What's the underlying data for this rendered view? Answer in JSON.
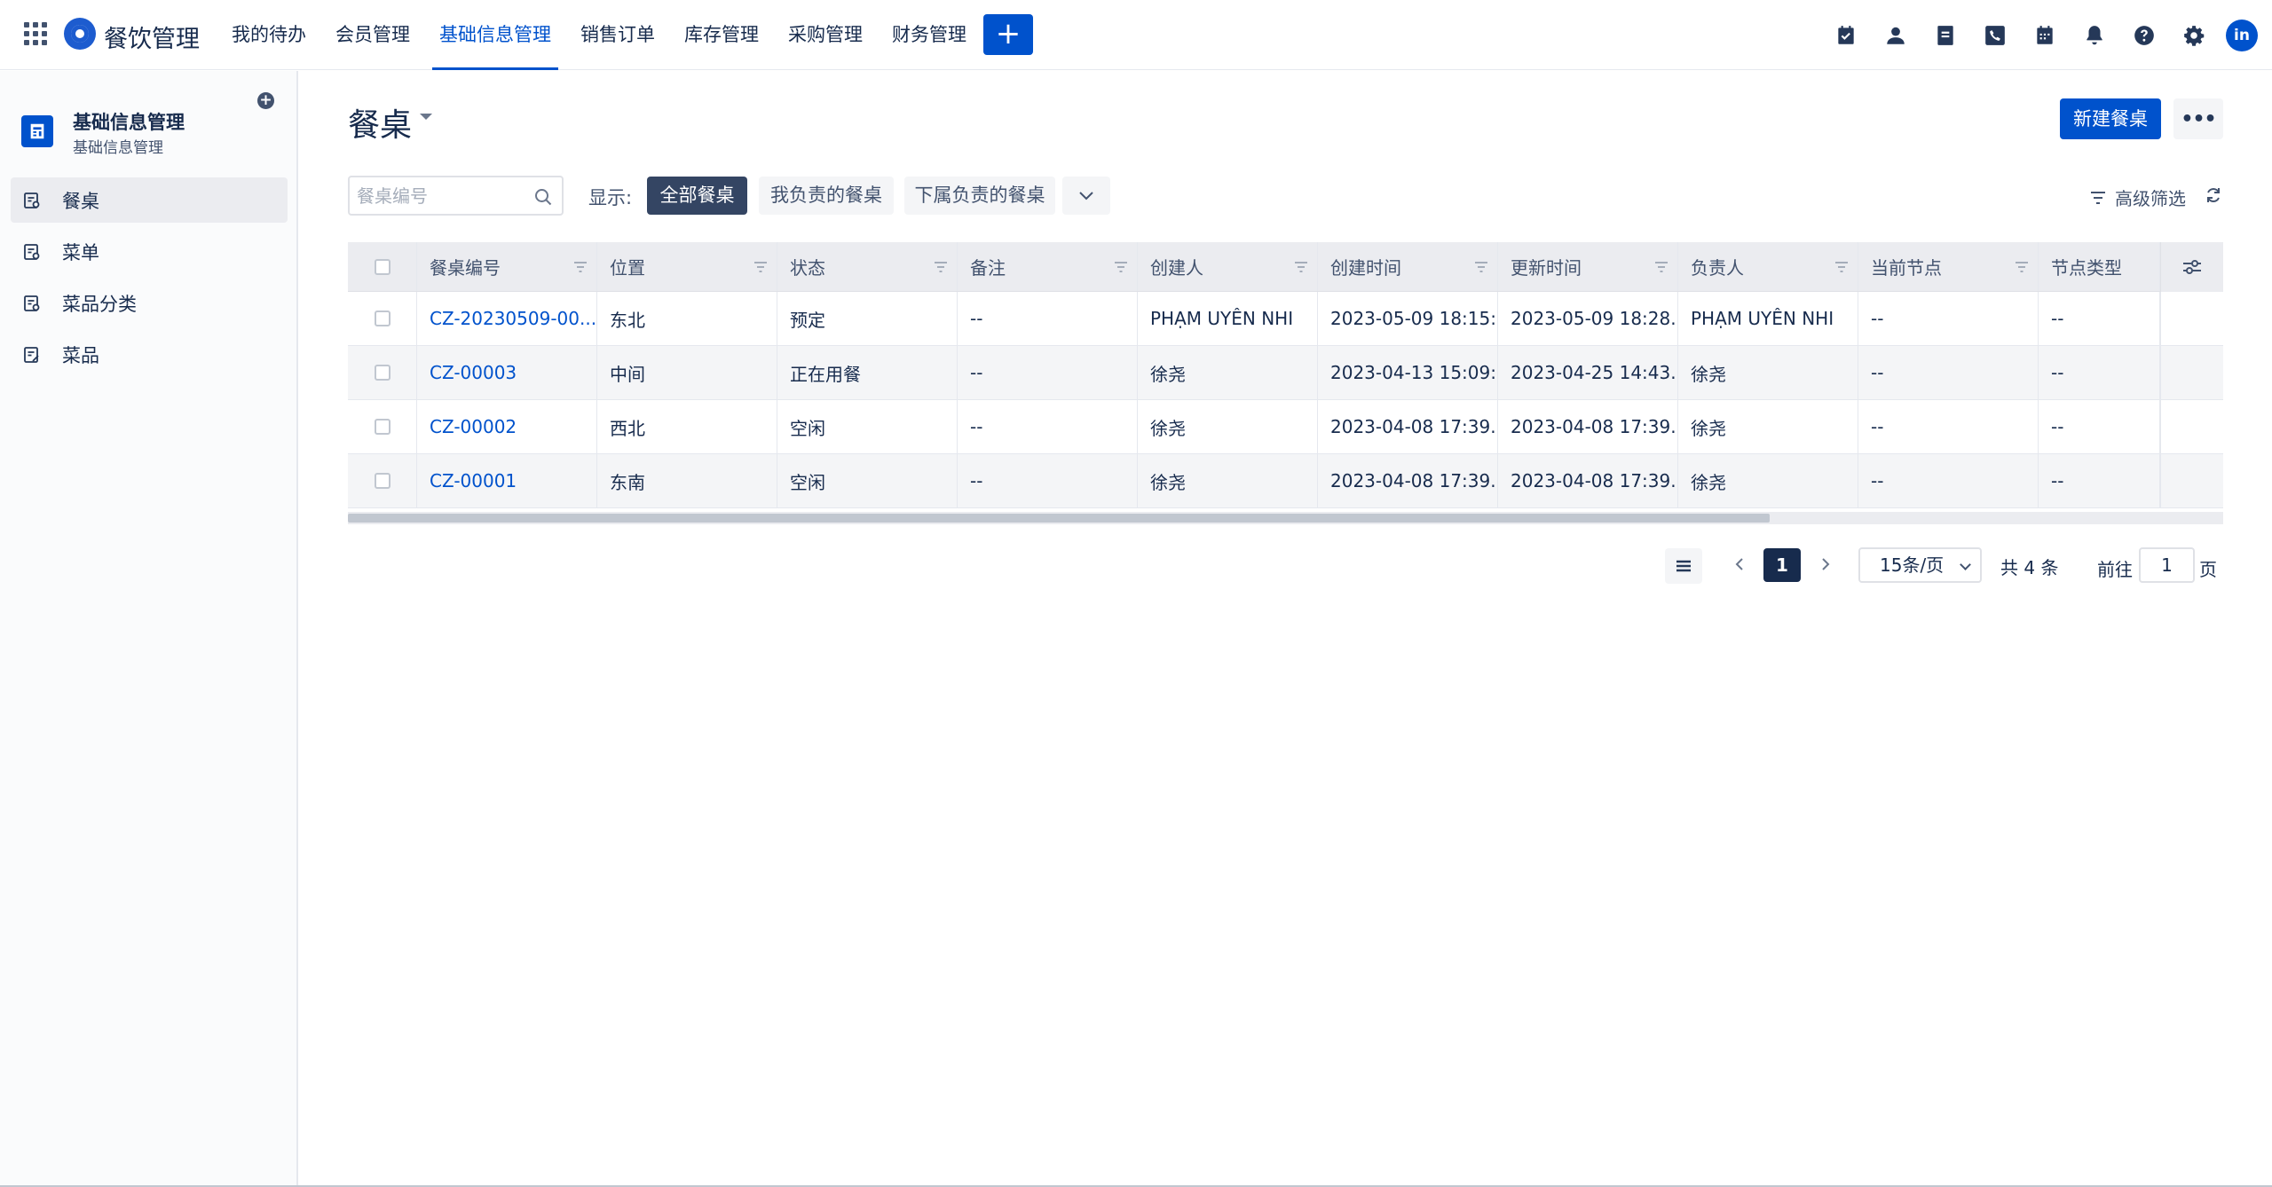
{
  "app": {
    "title": "餐饮管理",
    "nav": [
      "我的待办",
      "会员管理",
      "基础信息管理",
      "销售订单",
      "库存管理",
      "采购管理",
      "财务管理"
    ],
    "active_nav": "基础信息管理",
    "create_label": "+",
    "avatar_text": "in",
    "icons": [
      "calendar-check-icon",
      "user-icon",
      "document-icon",
      "phone-icon",
      "calendar-icon",
      "bell-icon",
      "help-icon",
      "gear-icon"
    ]
  },
  "sidebar": {
    "title": "基础信息管理",
    "subtitle": "基础信息管理",
    "items": [
      {
        "label": "餐桌",
        "active": true
      },
      {
        "label": "菜单",
        "active": false
      },
      {
        "label": "菜品分类",
        "active": false
      },
      {
        "label": "菜品",
        "active": false
      }
    ]
  },
  "page": {
    "title": "餐桌",
    "new_button": "新建餐桌",
    "search_placeholder": "餐桌编号",
    "show_label": "显示:",
    "filters": [
      "全部餐桌",
      "我负责的餐桌",
      "下属负责的餐桌"
    ],
    "active_filter": "全部餐桌",
    "advanced_filter": "高级筛选"
  },
  "table": {
    "columns": [
      "餐桌编号",
      "位置",
      "状态",
      "备注",
      "创建人",
      "创建时间",
      "更新时间",
      "负责人",
      "当前节点",
      "节点类型"
    ],
    "rows": [
      [
        "CZ-20230509-00...",
        "东北",
        "预定",
        "--",
        "PHẠM UYÊN NHI",
        "2023-05-09 18:15:...",
        "2023-05-09 18:28...",
        "PHẠM UYÊN NHI",
        "--",
        "--"
      ],
      [
        "CZ-00003",
        "中间",
        "正在用餐",
        "--",
        "徐尧",
        "2023-04-13 15:09:...",
        "2023-04-25 14:43...",
        "徐尧",
        "--",
        "--"
      ],
      [
        "CZ-00002",
        "西北",
        "空闲",
        "--",
        "徐尧",
        "2023-04-08 17:39...",
        "2023-04-08 17:39...",
        "徐尧",
        "--",
        "--"
      ],
      [
        "CZ-00001",
        "东南",
        "空闲",
        "--",
        "徐尧",
        "2023-04-08 17:39...",
        "2023-04-08 17:39...",
        "徐尧",
        "--",
        "--"
      ]
    ]
  },
  "pagination": {
    "current_page": "1",
    "page_size": "15条/页",
    "total": "共 4 条",
    "goto_label": "前往",
    "goto_value": "1",
    "page_unit": "页"
  },
  "colors": {
    "primary": "#0052cc",
    "active_filter_bg": "#344563",
    "header_bg": "#ebecf0"
  }
}
